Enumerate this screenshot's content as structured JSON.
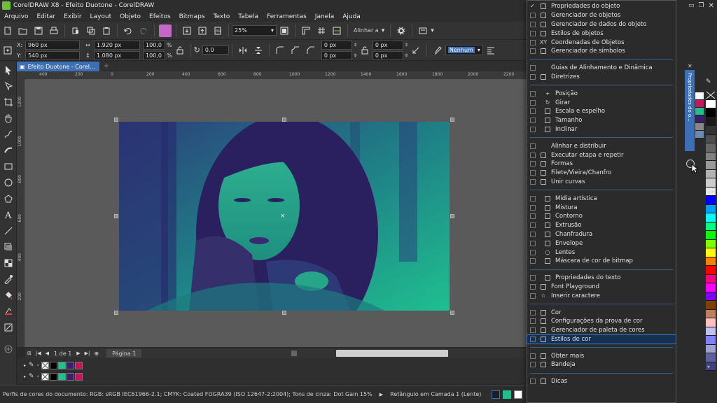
{
  "window": {
    "title": "CorelDRAW X8 - Efeito Duotone - CorelDRAW"
  },
  "menubar": {
    "items": [
      "Arquivo",
      "Editar",
      "Exibir",
      "Layout",
      "Objeto",
      "Efeitos",
      "Bitmaps",
      "Texto",
      "Tabela",
      "Ferramentas",
      "Janela",
      "Ajuda"
    ]
  },
  "standard_toolbar": {
    "zoom": "25%",
    "snap": "Alinhar a"
  },
  "property_bar": {
    "x": "960 px",
    "y": "540 px",
    "width": "1.920 px",
    "height": "1.080 px",
    "scale_w": "100,0",
    "scale_h": "100,0",
    "pct": "%",
    "angle": "0,0",
    "corner_1": "0 px",
    "corner_2": "0 px",
    "corner_3": "0 px",
    "corner_4": "0 px",
    "outline": "Nenhum"
  },
  "tabs": {
    "document": "Efeito Duotone - Corel..."
  },
  "ruler": {
    "top_ticks": [
      "400",
      "200",
      "0",
      "200",
      "400",
      "600",
      "800",
      "1000",
      "1200",
      "1400",
      "1600",
      "1800",
      "2000",
      "2200"
    ],
    "left_ticks": [
      "1200",
      "1000",
      "800",
      "600",
      "400",
      "200"
    ]
  },
  "pagebar": {
    "page_of": "1 de 1",
    "page_label": "Página 1"
  },
  "status": {
    "color_profiles": "Perfis de cores do documento: RGB: sRGB IEC61966-2.1; CMYK: Coated FOGRA39 (ISO 12647-2:2004); Tons de cinza: Dot Gain 15%",
    "selection": "Retângulo em Camada 1  (Lente)"
  },
  "dockers_menu": {
    "groups": [
      {
        "items": [
          {
            "label": "Propriedades do objeto",
            "icon": "properties-icon",
            "checked": true
          },
          {
            "label": "Gerenciador de objetos",
            "icon": "layers-icon",
            "checked": false
          },
          {
            "label": "Gerenciador de dados do objeto",
            "icon": "data-icon",
            "checked": false
          },
          {
            "label": "Estilos de objetos",
            "icon": "styles-icon",
            "checked": false
          },
          {
            "label": "Coordenadas de Objetos",
            "icon": "xy-icon",
            "glyph": "XY",
            "checked": false
          },
          {
            "label": "Gerenciador de símbolos",
            "icon": "symbol-icon",
            "checked": false
          }
        ]
      },
      {
        "items": [
          {
            "label": "Guias de Alinhamento e Dinâmica",
            "icon": "",
            "checked": false,
            "noicon": true
          },
          {
            "label": "Diretrizes",
            "icon": "guides-icon",
            "checked": false
          }
        ]
      },
      {
        "items": [
          {
            "label": "Posição",
            "icon": "position-icon",
            "glyph": "+",
            "checked": false,
            "indent": true
          },
          {
            "label": "Girar",
            "icon": "rotate-icon",
            "glyph": "↻",
            "checked": false,
            "indent": true
          },
          {
            "label": "Escala e espelho",
            "icon": "scale-icon",
            "checked": false,
            "indent": true
          },
          {
            "label": "Tamanho",
            "icon": "size-icon",
            "checked": false,
            "indent": true
          },
          {
            "label": "Inclinar",
            "icon": "skew-icon",
            "checked": false,
            "indent": true
          }
        ]
      },
      {
        "items": [
          {
            "label": "Alinhar e distribuir",
            "icon": "",
            "checked": false,
            "noicon": true
          },
          {
            "label": "Executar etapa e repetir",
            "icon": "step-icon",
            "checked": false
          },
          {
            "label": "Formas",
            "icon": "shapes-icon",
            "checked": false
          },
          {
            "label": "Filete/Vieira/Chanfro",
            "icon": "fillet-icon",
            "checked": false
          },
          {
            "label": "Unir curvas",
            "icon": "join-icon",
            "checked": false
          }
        ]
      },
      {
        "items": [
          {
            "label": "Mídia artística",
            "icon": "brush-icon",
            "checked": false,
            "indent": true
          },
          {
            "label": "Mistura",
            "icon": "blend-icon",
            "checked": false,
            "indent": true
          },
          {
            "label": "Contorno",
            "icon": "contour-icon",
            "checked": false,
            "indent": true
          },
          {
            "label": "Extrusão",
            "icon": "extrude-icon",
            "checked": false,
            "indent": true
          },
          {
            "label": "Chanfradura",
            "icon": "bevel-icon",
            "checked": false,
            "indent": true
          },
          {
            "label": "Envelope",
            "icon": "envelope-icon",
            "checked": false,
            "indent": true
          },
          {
            "label": "Lentes",
            "icon": "lens-icon",
            "glyph": "○",
            "checked": false,
            "indent": true
          },
          {
            "label": "Máscara de cor de bitmap",
            "icon": "mask-icon",
            "checked": false,
            "indent": true
          }
        ]
      },
      {
        "items": [
          {
            "label": "Propriedades do texto",
            "icon": "text-props-icon",
            "checked": false,
            "indent": true
          },
          {
            "label": "Font Playground",
            "icon": "font-icon",
            "checked": false
          },
          {
            "label": "Inserir caractere",
            "icon": "star-icon",
            "glyph": "☆",
            "checked": false
          }
        ]
      },
      {
        "items": [
          {
            "label": "Cor",
            "icon": "color-icon",
            "checked": false
          },
          {
            "label": "Configurações da prova de cor",
            "icon": "proof-icon",
            "checked": false
          },
          {
            "label": "Gerenciador de paleta de cores",
            "icon": "palette-icon",
            "checked": false
          },
          {
            "label": "Estilos de cor",
            "icon": "color-styles-icon",
            "checked": false,
            "highlight": true
          }
        ]
      },
      {
        "items": [
          {
            "label": "Obter mais",
            "icon": "more-icon",
            "checked": false
          },
          {
            "label": "Bandeja",
            "icon": "tray-icon",
            "checked": false
          }
        ]
      },
      {
        "items": [
          {
            "label": "Dicas",
            "icon": "hints-icon",
            "checked": false
          }
        ]
      }
    ]
  },
  "dock_tab": {
    "label": "Propriedades do o..."
  },
  "colors": {
    "accent": "#3d6fb5",
    "duotone_dark": "#3a1f6b",
    "duotone_light": "#1fbf8f",
    "palette": [
      "#ffffff",
      "#000000",
      "#1a1a1a",
      "#333333",
      "#4d4d4d",
      "#666666",
      "#808080",
      "#999999",
      "#b3b3b3",
      "#cccccc",
      "#e6e6e6",
      "#0000ff",
      "#00a0ff",
      "#00ffff",
      "#00ff80",
      "#00ff00",
      "#80ff00",
      "#ffff00",
      "#ff8000",
      "#ff0000",
      "#ff0080",
      "#ff00ff",
      "#8000ff",
      "#804000",
      "#c08060",
      "#ffc0c0",
      "#c0c0ff",
      "#8080ff",
      "#a0a0d0",
      "#6060a0",
      "#404080"
    ],
    "doc_swatches": [
      "#ffffff",
      "#000000",
      "#1fbf8f",
      "#3a1f6b",
      "#c2185b"
    ]
  }
}
